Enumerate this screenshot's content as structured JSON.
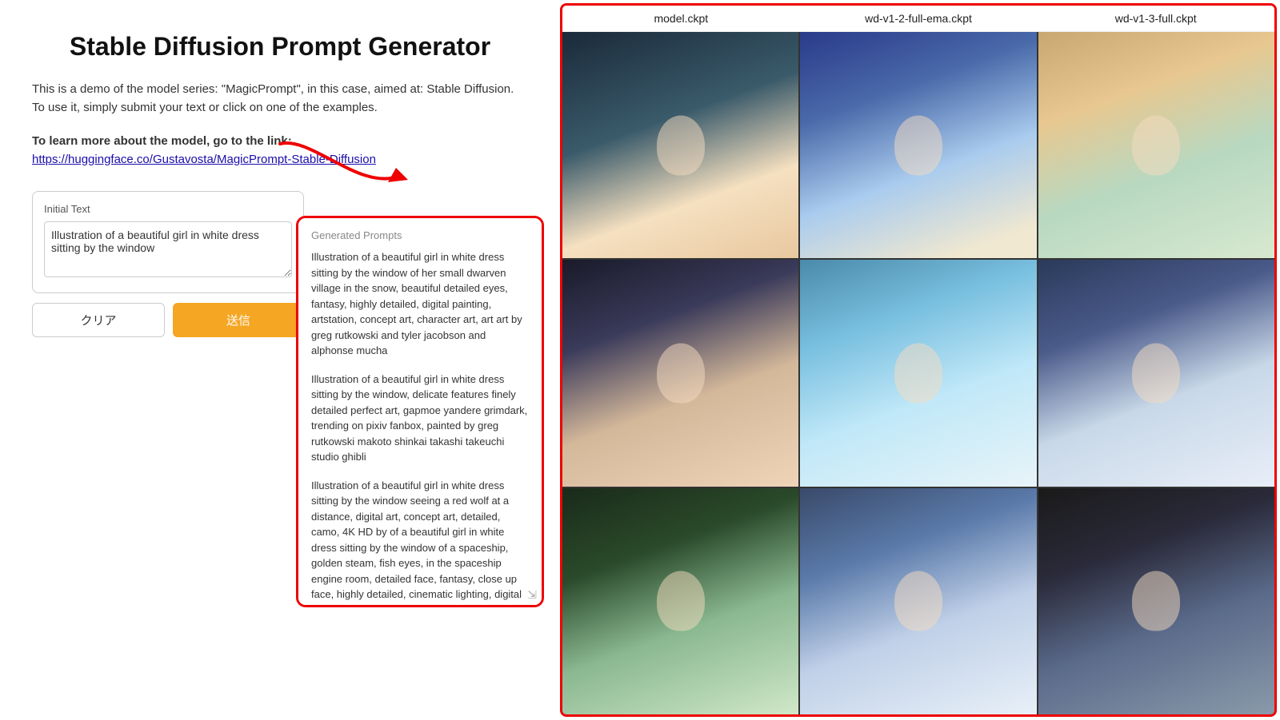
{
  "page": {
    "title": "Stable Diffusion Prompt Generator",
    "description": "This is a demo of the model series: \"MagicPrompt\", in this case, aimed at: Stable Diffusion. To use it, simply submit your text or click on one of the examples.",
    "learn_more_label": "To learn more about the model, go to the link:",
    "learn_more_link": "https://huggingface.co/Gustavosta/MagicPrompt-Stable-Diffusion",
    "input_label": "Initial Text",
    "input_placeholder": "Illustration of a beautiful girl in white dress sitting by the window",
    "input_value": "Illustration of a beautiful girl in white dress sitting by the window",
    "btn_clear": "クリア",
    "btn_send": "送信",
    "generated_label": "Generated Prompts",
    "prompts": [
      "Illustration of a beautiful girl in white dress sitting by the window of her small dwarven village in the snow, beautiful detailed eyes, fantasy, highly detailed, digital painting, artstation, concept art, character art, art art by greg rutkowski and tyler jacobson and alphonse mucha",
      "Illustration of a beautiful girl in white dress sitting by the window, delicate features finely detailed perfect art, gapmoe yandere grimdark, trending on pixiv fanbox, painted by greg rutkowski makoto shinkai takashi takeuchi studio ghibli",
      "Illustration of a beautiful girl in white dress sitting by the window seeing a red wolf at a distance, digital art, concept art, detailed, camo, 4K HD by of a beautiful girl in white dress sitting by the window of a spaceship, golden steam, fish eyes, in the spaceship engine room, detailed face, fantasy, close up face, highly detailed, cinematic lighting, digital art painting artwork by artgerm and greg rutkowski"
    ],
    "right_panel": {
      "columns": [
        "model.ckpt",
        "wd-v1-2-full-ema.ckpt",
        "wd-v1-3-full.ckpt"
      ]
    }
  }
}
